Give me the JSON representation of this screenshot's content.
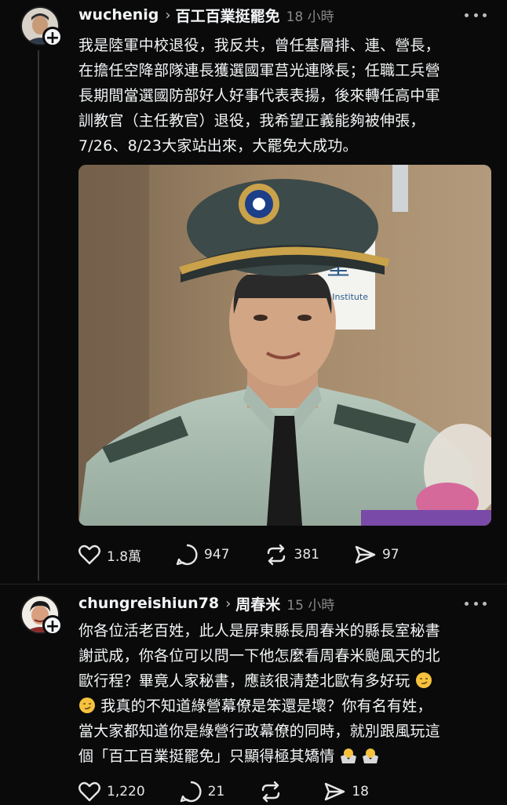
{
  "posts": [
    {
      "username": "wuchenig",
      "community": "百工百業挺罷免",
      "time": "18 小時",
      "text_lines": [
        "我是陸軍中校退役，我反共，曾任基層排、連、營長，",
        "在擔任空降部隊連長獲選國軍莒光連隊長；任職工兵營",
        "長期間當選國防部好人好事代表表揚，後來轉任高中軍",
        "訓教官（主任教官）退役，我希望正義能夠被伸張，",
        "7/26、8/23大家站出來，大罷免大成功。"
      ],
      "photo_sign_text": "堂",
      "photo_sign_sub": "al Institute",
      "actions": {
        "likes": "1.8萬",
        "comments": "947",
        "reposts": "381",
        "shares": "97"
      }
    },
    {
      "username": "chungreishiun78",
      "community": "周春米",
      "time": "15 小時",
      "text_lines": [
        "你各位活老百姓，此人是屏東縣長周春米的縣長室秘書",
        "謝武成，你各位可以問一下他怎麼看周春米颱風天的北",
        "歐行程？畢竟人家秘書，應該很清楚北歐有多好玩",
        "我真的不知道綠營幕僚是笨還是壞？你有名有姓，",
        "當大家都知道你是綠營行政幕僚的同時，就別跟風玩這",
        "個「百工百業挺罷免」只顯得極其矯情"
      ],
      "actions": {
        "likes": "1,220",
        "comments": "21",
        "reposts": "",
        "shares": "18"
      }
    }
  ],
  "colors": {
    "background": "#0a0a0a",
    "text": "#f3f5f7",
    "muted": "#8a8a8a"
  },
  "icons": [
    "heart-icon",
    "comment-icon",
    "repost-icon",
    "share-icon",
    "more-icon",
    "follow-plus-icon",
    "chevron-right-icon"
  ]
}
